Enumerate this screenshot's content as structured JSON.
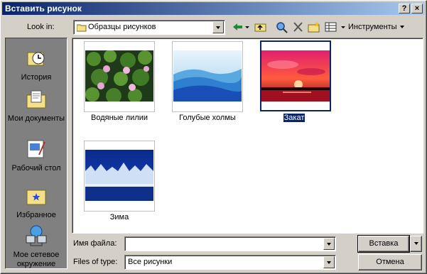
{
  "window": {
    "title": "Вставить рисунок",
    "help_glyph": "?",
    "close_glyph": "×"
  },
  "toolbar": {
    "look_in_label": "Look in:",
    "look_in_value": "Образцы рисунков",
    "tools_label": "Инструменты"
  },
  "places": [
    {
      "label": "История",
      "icon": "history-icon"
    },
    {
      "label": "Мои документы",
      "icon": "my-documents-icon"
    },
    {
      "label": "Рабочий стол",
      "icon": "desktop-icon"
    },
    {
      "label": "Избранное",
      "icon": "favorites-icon"
    },
    {
      "label": "Мое сетевое окружение",
      "icon": "network-places-icon"
    }
  ],
  "files": [
    {
      "name": "Водяные лилии",
      "selected": false
    },
    {
      "name": "Голубые холмы",
      "selected": false
    },
    {
      "name": "Закат",
      "selected": true
    },
    {
      "name": "Зима",
      "selected": false
    }
  ],
  "footer": {
    "filename_label": "Имя файла:",
    "filename_value": "",
    "filetype_label": "Files of type:",
    "filetype_value": "Все рисунки",
    "insert_label": "Вставка",
    "cancel_label": "Отмена"
  },
  "colors": {
    "title_start": "#0a246a",
    "title_end": "#a6caf0",
    "dialog_bg": "#d4d0c8",
    "selection": "#0a246a"
  }
}
